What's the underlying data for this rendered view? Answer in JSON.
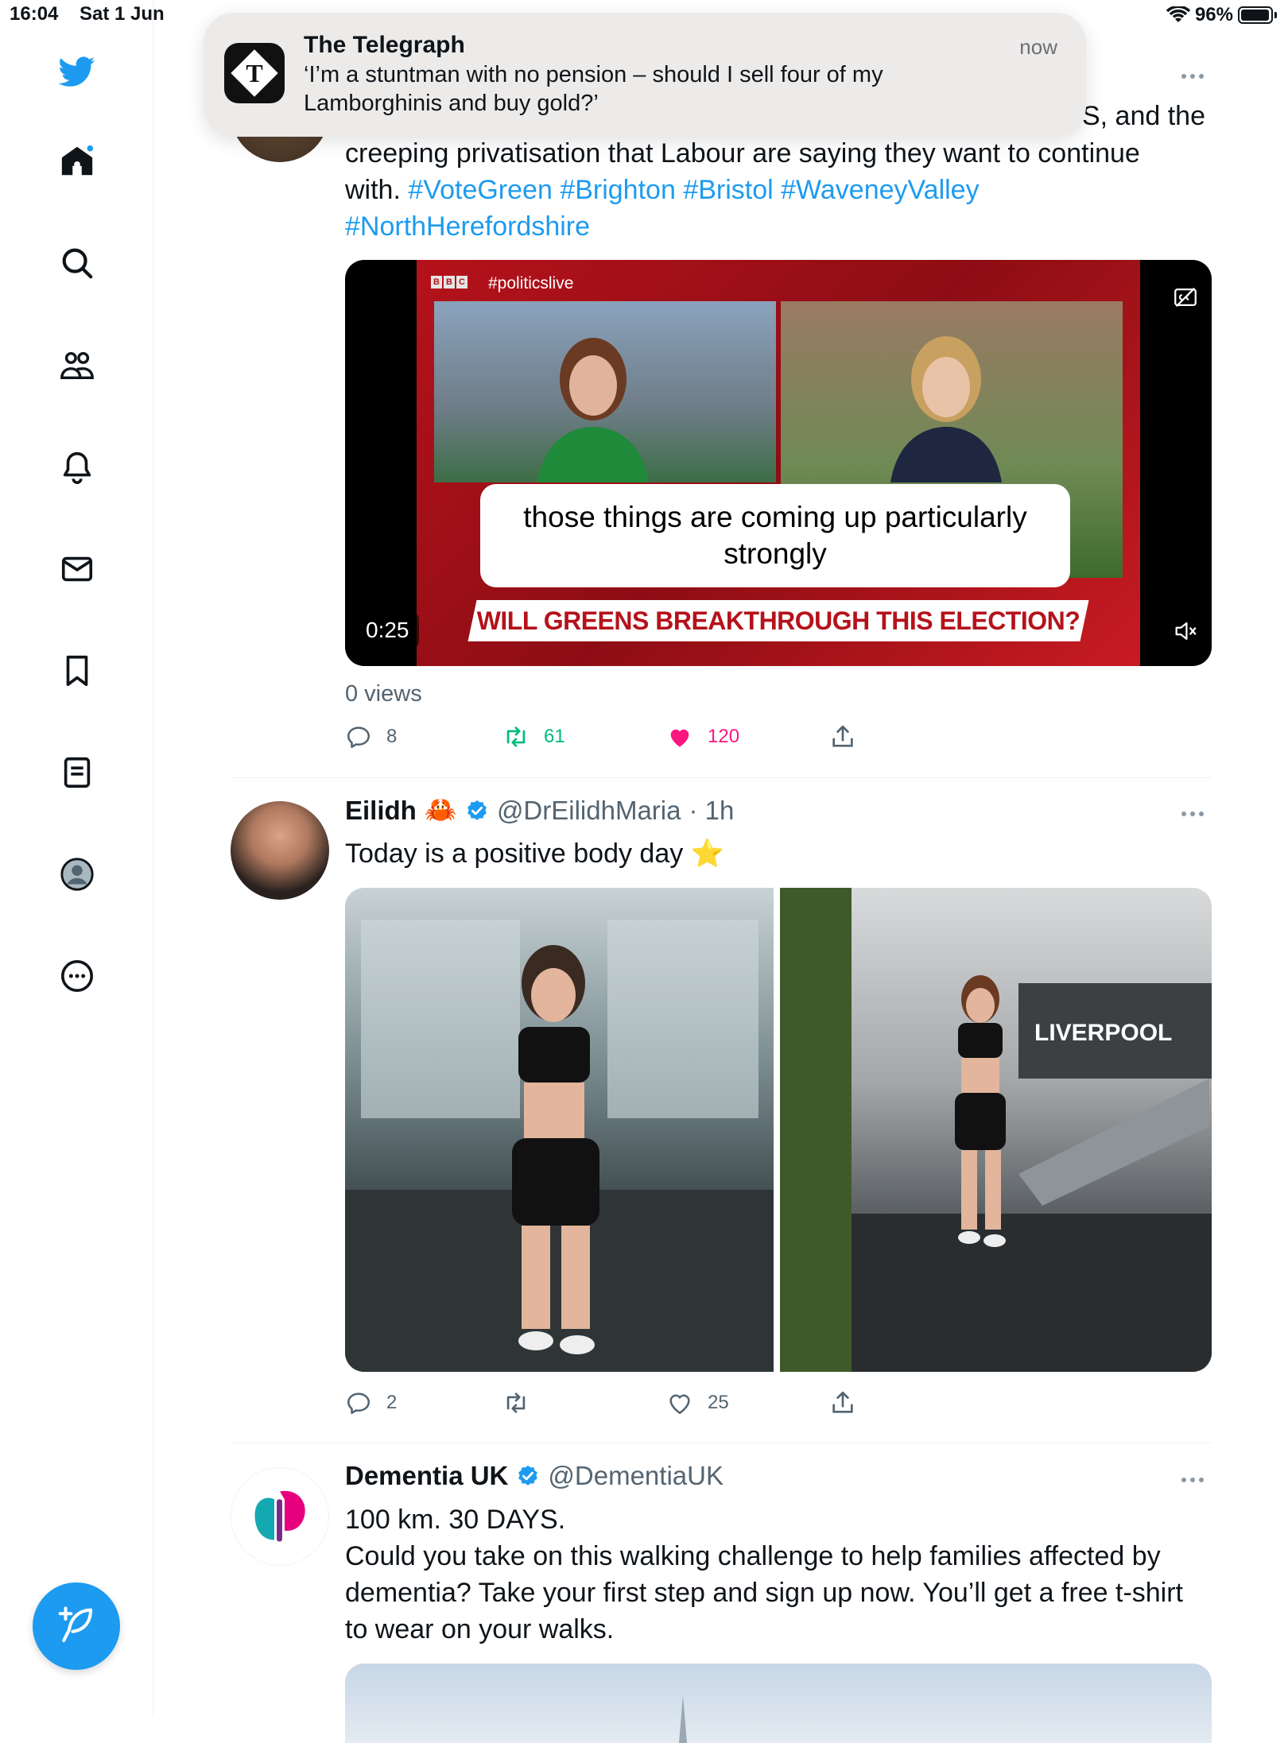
{
  "status_bar": {
    "time": "16:04",
    "date": "Sat 1 Jun",
    "battery": "96%",
    "battery_level": 0.96
  },
  "notification": {
    "app": "The Telegraph",
    "time": "now",
    "body": "‘I’m a stuntman with no pension – should I sell four of my Lamborghinis and buy gold?’"
  },
  "sidebar": {
    "items": [
      {
        "icon": "twitter-bird-icon"
      },
      {
        "icon": "home-icon"
      },
      {
        "icon": "search-icon"
      },
      {
        "icon": "communities-icon"
      },
      {
        "icon": "notifications-bell-icon"
      },
      {
        "icon": "messages-envelope-icon"
      },
      {
        "icon": "bookmark-icon"
      },
      {
        "icon": "lists-icon"
      },
      {
        "icon": "profile-avatar-icon"
      },
      {
        "icon": "more-circle-icon"
      }
    ],
    "compose_icon": "compose-feather-icon"
  },
  "tweets": [
    {
      "text_partial_top": "S, and the",
      "text_line_2": "creeping privatisation that Labour are saying they want to continue",
      "text_with": "with.",
      "hashtags": [
        "#VoteGreen",
        "#Brighton",
        "#Bristol",
        "#WaveneyValley",
        "#NorthHerefordshire"
      ],
      "video": {
        "overlay_hashtag": "#politicslive",
        "caption": "those things are coming up particularly strongly",
        "banner": "WILL GREENS BREAKTHROUGH THIS ELECTION?",
        "timer": "0:25"
      },
      "views": "0 views",
      "replies": "8",
      "retweets": "61",
      "likes": "120",
      "liked": true
    },
    {
      "name": "Eilidh",
      "emoji": "🦀",
      "verified": true,
      "handle": "@DrEilidhMaria",
      "time": "· 1h",
      "text": "Today is a positive body day ⭐",
      "photo_sign": "LIVERPOOL",
      "replies": "2",
      "retweets": "",
      "likes": "25"
    },
    {
      "name": "Dementia UK",
      "verified": true,
      "handle": "@DementiaUK",
      "text_lines": [
        "100 km. 30 DAYS.",
        "Could you take on this walking challenge to help families affected by",
        "dementia? Take your first step and sign up now. You’ll get a free t-shirt",
        "to wear on your walks."
      ]
    }
  ],
  "colors": {
    "accent": "#1d9bf0",
    "like": "#f91880",
    "retweet": "#00ba7c",
    "muted": "#536471"
  }
}
